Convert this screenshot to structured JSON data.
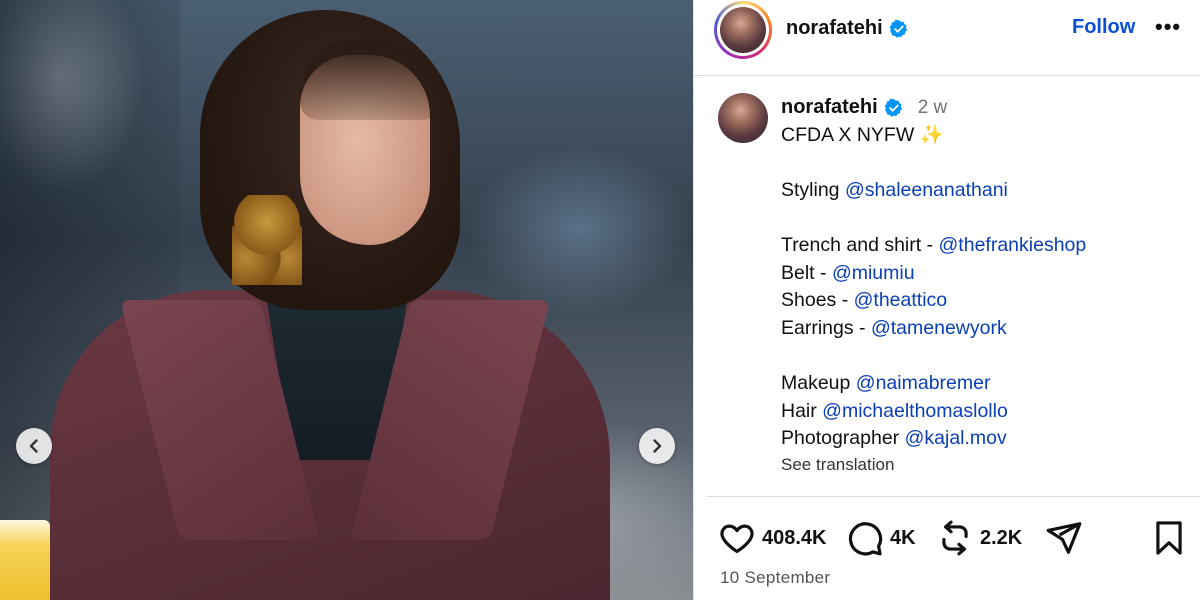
{
  "header": {
    "username": "norafatehi",
    "follow_label": "Follow",
    "more_label": "•••"
  },
  "caption": {
    "username": "norafatehi",
    "time_ago": "2 w",
    "title": "CFDA X NYFW",
    "title_emoji": "✨",
    "styling_label": "Styling",
    "styling_handle": "@shaleenanathani",
    "credits": [
      {
        "label": "Trench and shirt - ",
        "handle": "@thefrankieshop"
      },
      {
        "label": "Belt - ",
        "handle": "@miumiu"
      },
      {
        "label": "Shoes - ",
        "handle": "@theattico"
      },
      {
        "label": "Earrings - ",
        "handle": "@tamenewyork"
      }
    ],
    "team": [
      {
        "label": "Makeup ",
        "handle": "@naimabremer"
      },
      {
        "label": "Hair ",
        "handle": "@michaelthomaslollo"
      },
      {
        "label": "Photographer ",
        "handle": "@kajal.mov"
      }
    ],
    "see_translation": "See translation"
  },
  "actions": {
    "likes": "408.4K",
    "comments": "4K",
    "reposts": "2.2K"
  },
  "post_date": "10 September",
  "colors": {
    "link": "#0a3fb8",
    "follow": "#0a4fd6",
    "verified": "#0095f6"
  },
  "icons": [
    "chevron-left-icon",
    "chevron-right-icon",
    "verified-badge-icon",
    "heart-icon",
    "comment-icon",
    "repost-icon",
    "share-icon",
    "bookmark-icon",
    "more-icon"
  ]
}
